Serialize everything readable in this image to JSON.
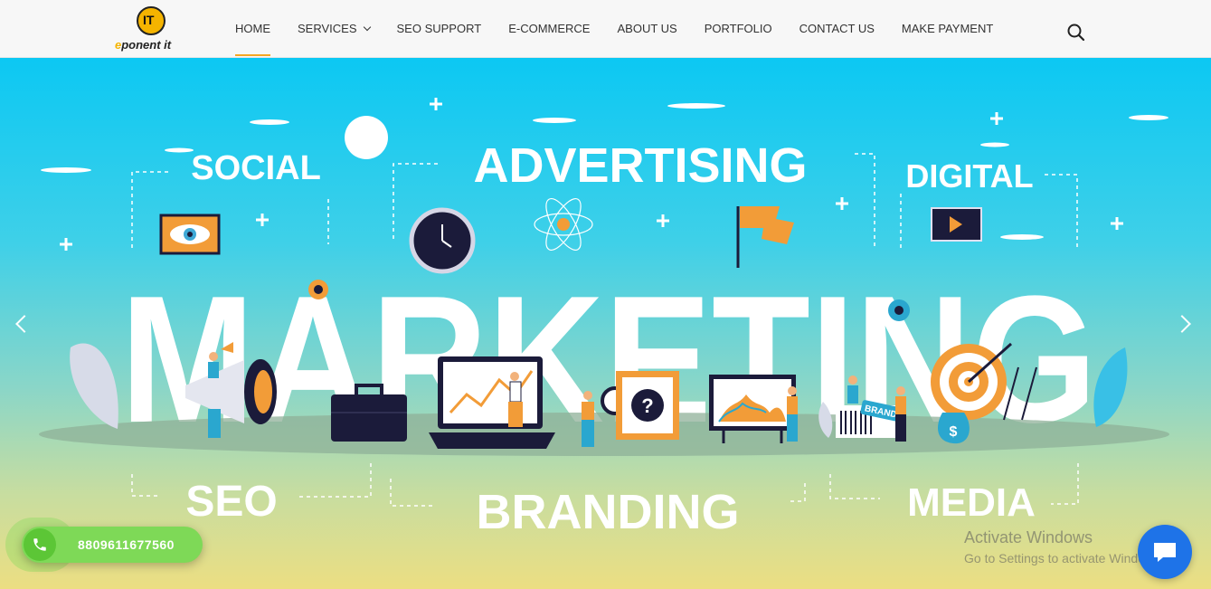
{
  "brand": {
    "logo_mark": "IT",
    "logo_text_prefix": "e",
    "logo_text_rest": "ponent it",
    "accent": "#f5b400"
  },
  "nav": {
    "items": [
      {
        "label": "HOME",
        "active": true
      },
      {
        "label": "SERVICES",
        "has_dropdown": true
      },
      {
        "label": "SEO SUPPORT"
      },
      {
        "label": "E-COMMERCE"
      },
      {
        "label": "ABOUT US"
      },
      {
        "label": "PORTFOLIO"
      },
      {
        "label": "CONTACT US"
      },
      {
        "label": "MAKE PAYMENT"
      }
    ],
    "search_icon": "search-icon",
    "active_color": "#f5a623"
  },
  "hero": {
    "words": {
      "social": "SOCIAL",
      "advertising": "ADVERTISING",
      "digital": "DIGITAL",
      "marketing": "MARKETING",
      "seo": "SEO",
      "branding": "BRANDING",
      "media": "MEDIA",
      "brand_tag": "BRAND"
    },
    "prev_icon": "chevron-left-icon",
    "next_icon": "chevron-right-icon"
  },
  "call": {
    "number": "8809611677560",
    "icon": "phone-icon",
    "color": "#7ed957"
  },
  "watermark": {
    "title": "Activate Windows",
    "subtitle": "Go to Settings to activate Windows."
  },
  "chat": {
    "icon": "chat-icon",
    "color": "#1e73e8"
  }
}
